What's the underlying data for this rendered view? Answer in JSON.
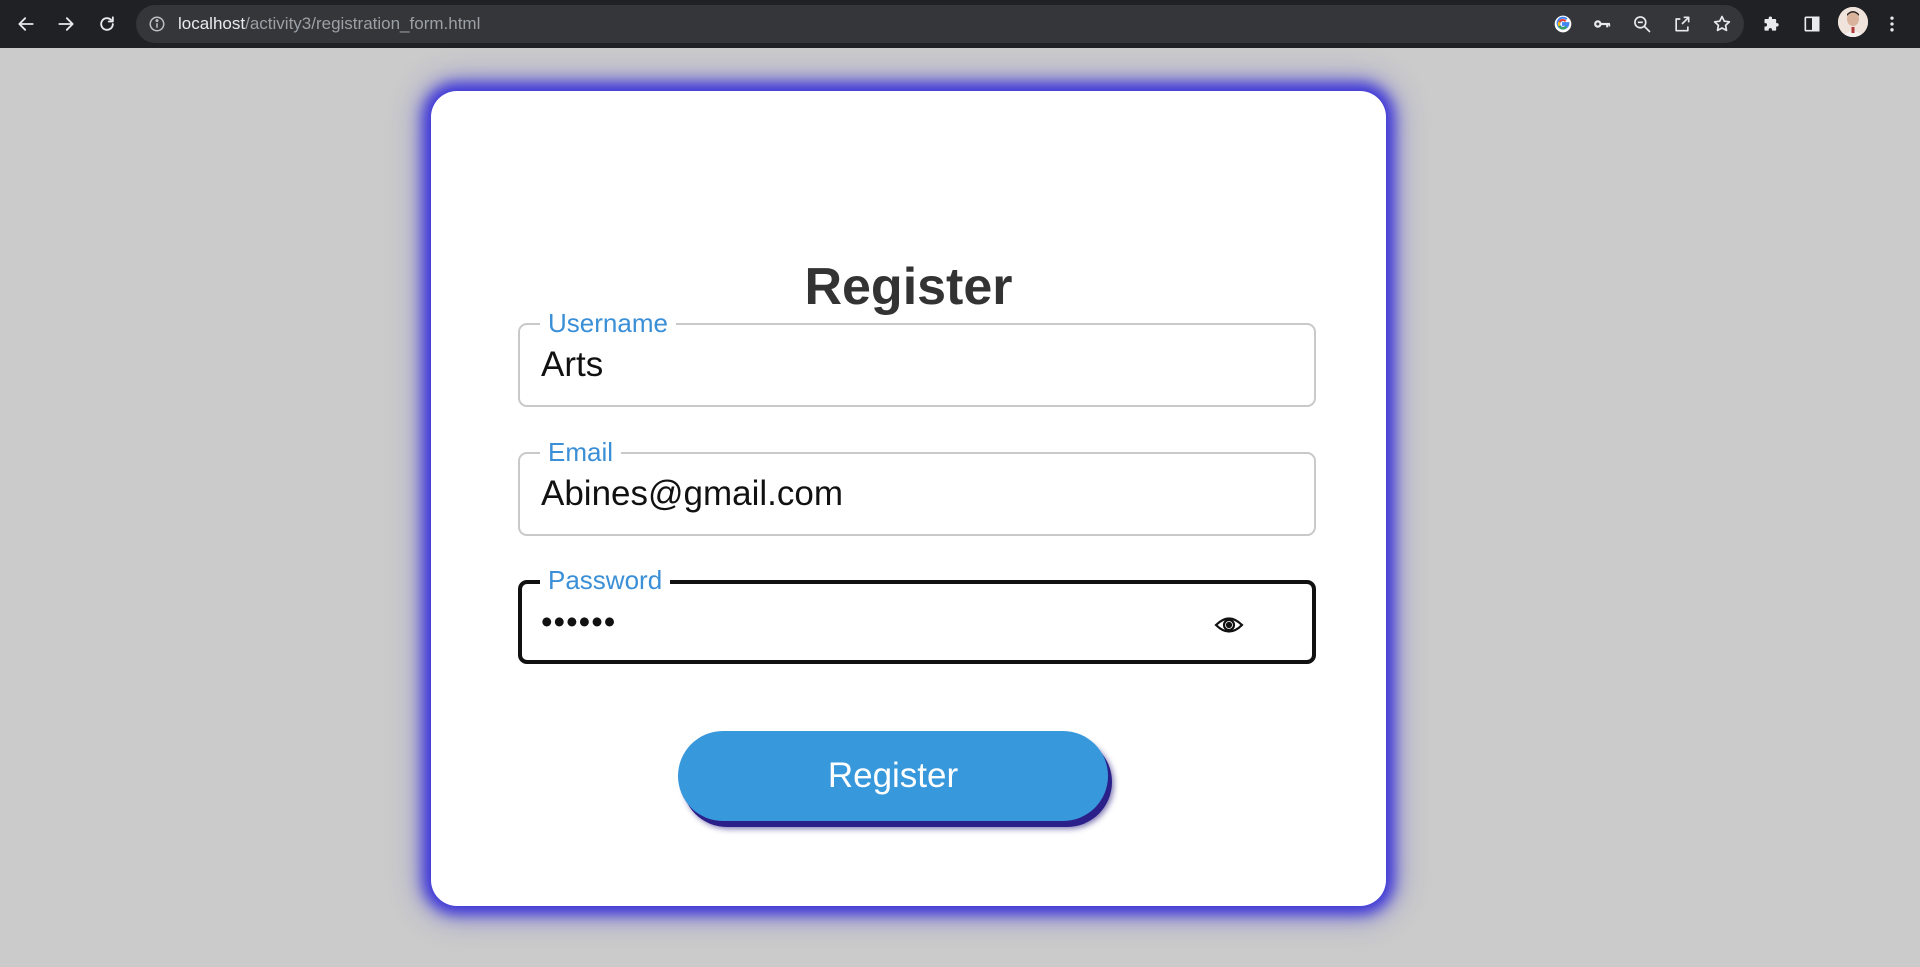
{
  "browser": {
    "url_host": "localhost",
    "url_path": "/activity3/registration_form.html"
  },
  "form": {
    "title": "Register",
    "username": {
      "label": "Username",
      "value": "Arts"
    },
    "email": {
      "label": "Email",
      "value": "Abines@gmail.com"
    },
    "password": {
      "label": "Password",
      "value_masked": "••••••"
    },
    "submit_label": "Register"
  },
  "colors": {
    "page_background": "#cbcbcb",
    "card_glow": "#3c35d8",
    "accent_blue": "#3898dc",
    "label_blue": "#3a8fd6",
    "title_text": "#333333"
  },
  "icons": {
    "back": "arrow-left",
    "forward": "arrow-right",
    "reload": "refresh",
    "site_info": "info-circle",
    "google": "google-logo",
    "password_key": "key",
    "zoom": "zoom-out",
    "share": "share",
    "bookmark": "star",
    "extensions": "puzzle",
    "side_panel": "side-panel",
    "menu": "kebab",
    "password_visibility": "eye"
  }
}
